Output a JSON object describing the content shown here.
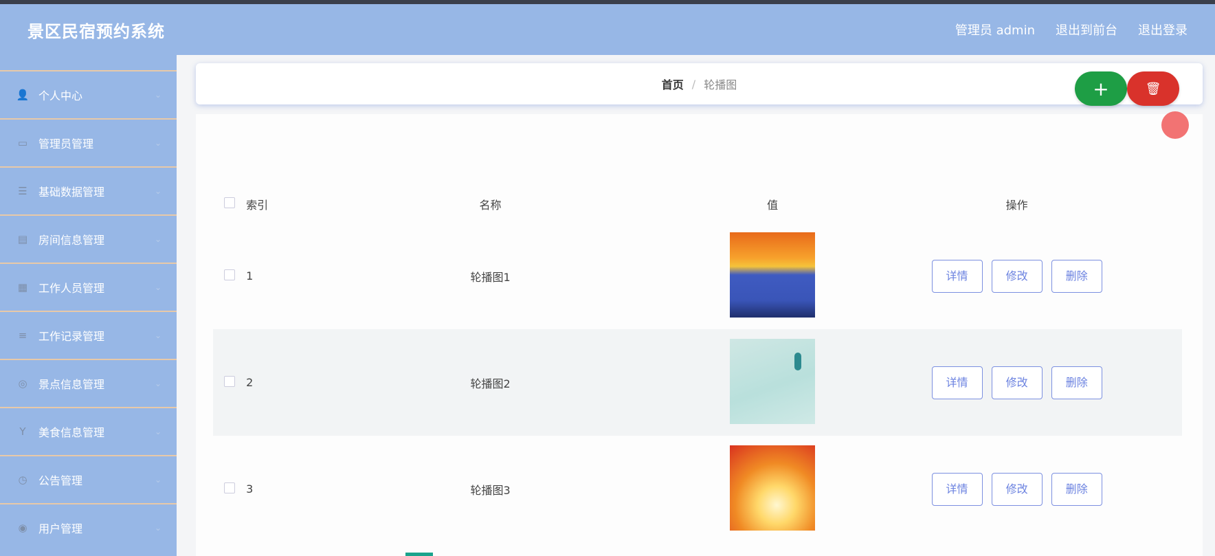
{
  "header": {
    "title": "景区民宿预约系统",
    "user": "管理员 admin",
    "back_to_front": "退出到前台",
    "logout": "退出登录"
  },
  "sidebar": {
    "items": [
      {
        "label": "个人中心",
        "icon": "user-icon"
      },
      {
        "label": "管理员管理",
        "icon": "admin-card-icon"
      },
      {
        "label": "基础数据管理",
        "icon": "list-icon"
      },
      {
        "label": "房间信息管理",
        "icon": "room-icon"
      },
      {
        "label": "工作人员管理",
        "icon": "staff-icon"
      },
      {
        "label": "工作记录管理",
        "icon": "record-icon"
      },
      {
        "label": "景点信息管理",
        "icon": "scenic-icon"
      },
      {
        "label": "美食信息管理",
        "icon": "food-icon"
      },
      {
        "label": "公告管理",
        "icon": "notice-icon"
      },
      {
        "label": "用户管理",
        "icon": "users-icon"
      }
    ]
  },
  "breadcrumb": {
    "home": "首页",
    "separator": "/",
    "current": "轮播图"
  },
  "toolbar": {
    "add_symbol": "+",
    "delete_symbol": "🗑"
  },
  "table": {
    "headers": {
      "index": "索引",
      "name": "名称",
      "value": "值",
      "ops": "操作"
    },
    "rows": [
      {
        "index": "1",
        "name": "轮播图1",
        "detail": "详情",
        "edit": "修改",
        "delete": "删除"
      },
      {
        "index": "2",
        "name": "轮播图2",
        "detail": "详情",
        "edit": "修改",
        "delete": "删除"
      },
      {
        "index": "3",
        "name": "轮播图3",
        "detail": "详情",
        "edit": "修改",
        "delete": "删除"
      }
    ]
  },
  "colors": {
    "header_bg": "#97b7e6",
    "add_button": "#1e9e45",
    "delete_button": "#d9322b",
    "op_button_text": "#6b82e0"
  }
}
